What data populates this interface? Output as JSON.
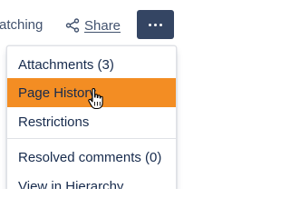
{
  "toolbar": {
    "watch_label": "atching",
    "share_label": "Share",
    "share_icon": "share-icon",
    "more_icon": "more-horizontal-icon",
    "more_button_color": "#344563"
  },
  "menu": {
    "items": [
      {
        "label": "Attachments (3)"
      },
      {
        "label": "Page History"
      },
      {
        "label": "Restrictions"
      },
      {
        "label": "Resolved comments (0)"
      },
      {
        "label": "View in Hierarchy"
      }
    ],
    "highlight_color": "#f38d23"
  },
  "cursor": {
    "icon": "hand-pointer-icon"
  }
}
